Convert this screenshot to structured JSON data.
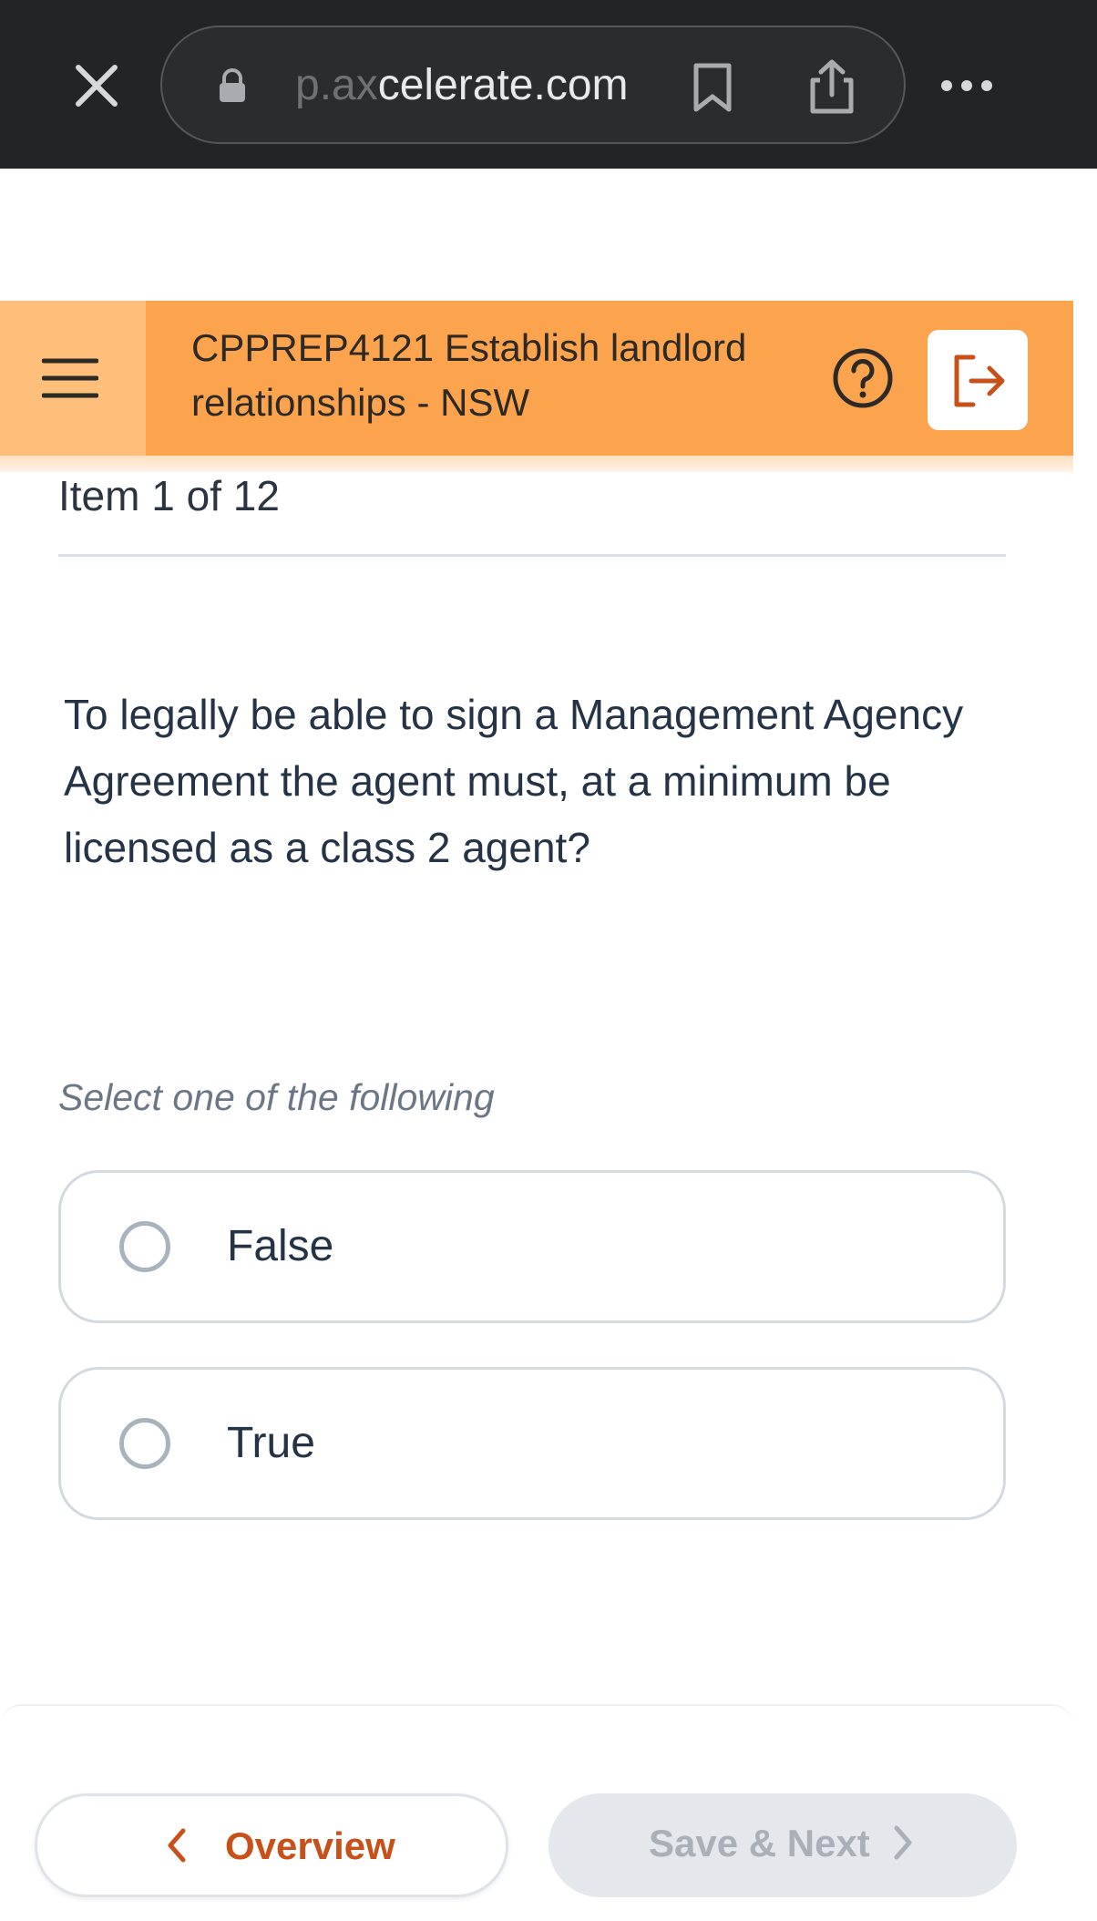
{
  "browser": {
    "url_faded": "p.ax",
    "url_main": "celerate.com",
    "icons": [
      "close-icon",
      "lock-icon",
      "bookmark-icon",
      "share-icon",
      "more-icon"
    ]
  },
  "header": {
    "title_line1": "CPPREP4121 Establish landlord",
    "title_line2": "relationships - NSW",
    "accent_color": "#fba34d",
    "icons": [
      "menu-icon",
      "help-icon",
      "logout-icon"
    ]
  },
  "assessment": {
    "item_counter": "Item 1 of 12",
    "question": "To legally be able to sign a Management Agency Agreement the agent must, at a minimum be licensed as a class 2 agent?",
    "instruction": "Select one of the following",
    "options": [
      {
        "label": "False",
        "selected": false
      },
      {
        "label": "True",
        "selected": false
      }
    ]
  },
  "footer": {
    "overview_label": "Overview",
    "save_next_label": "Save & Next",
    "save_next_enabled": false,
    "primary_color": "#c8501a"
  }
}
